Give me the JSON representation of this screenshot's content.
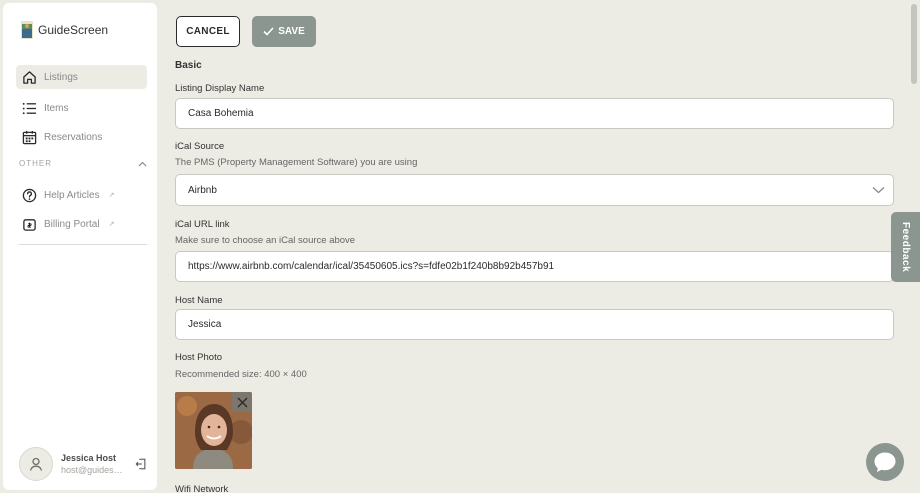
{
  "brand": {
    "name": "GuideScreen"
  },
  "sidebar": {
    "items": [
      {
        "label": "Listings",
        "icon": "home-icon",
        "active": true
      },
      {
        "label": "Items",
        "icon": "list-icon"
      },
      {
        "label": "Reservations",
        "icon": "calendar-icon"
      }
    ],
    "section_label": "OTHER",
    "other_items": [
      {
        "label": "Help Articles",
        "icon": "help-circle-icon",
        "ext": "↗"
      },
      {
        "label": "Billing Portal",
        "icon": "billing-icon",
        "ext": "↗"
      }
    ],
    "user": {
      "name": "Jessica Host",
      "email": "host@guidescreen.com"
    }
  },
  "toolbar": {
    "cancel_label": "CANCEL",
    "save_label": "SAVE"
  },
  "form": {
    "section_title": "Basic",
    "display_name": {
      "label": "Listing Display Name",
      "value": "Casa Bohemia"
    },
    "ical_source": {
      "label": "iCal Source",
      "help": "The PMS (Property Management Software) you are using",
      "value": "Airbnb"
    },
    "ical_url": {
      "label": "iCal URL link",
      "help": "Make sure to choose an iCal source above",
      "value": "https://www.airbnb.com/calendar/ical/35450605.ics?s=fdfe02b1f240b8b92b457b91"
    },
    "host_name": {
      "label": "Host Name",
      "value": "Jessica"
    },
    "host_photo": {
      "label": "Host Photo",
      "help": "Recommended size: 400 × 400"
    },
    "wifi_label": "Wifi Network"
  },
  "feedback_label": "Feedback",
  "colors": {
    "accent": "#8b9690",
    "background": "#ecebe4"
  }
}
